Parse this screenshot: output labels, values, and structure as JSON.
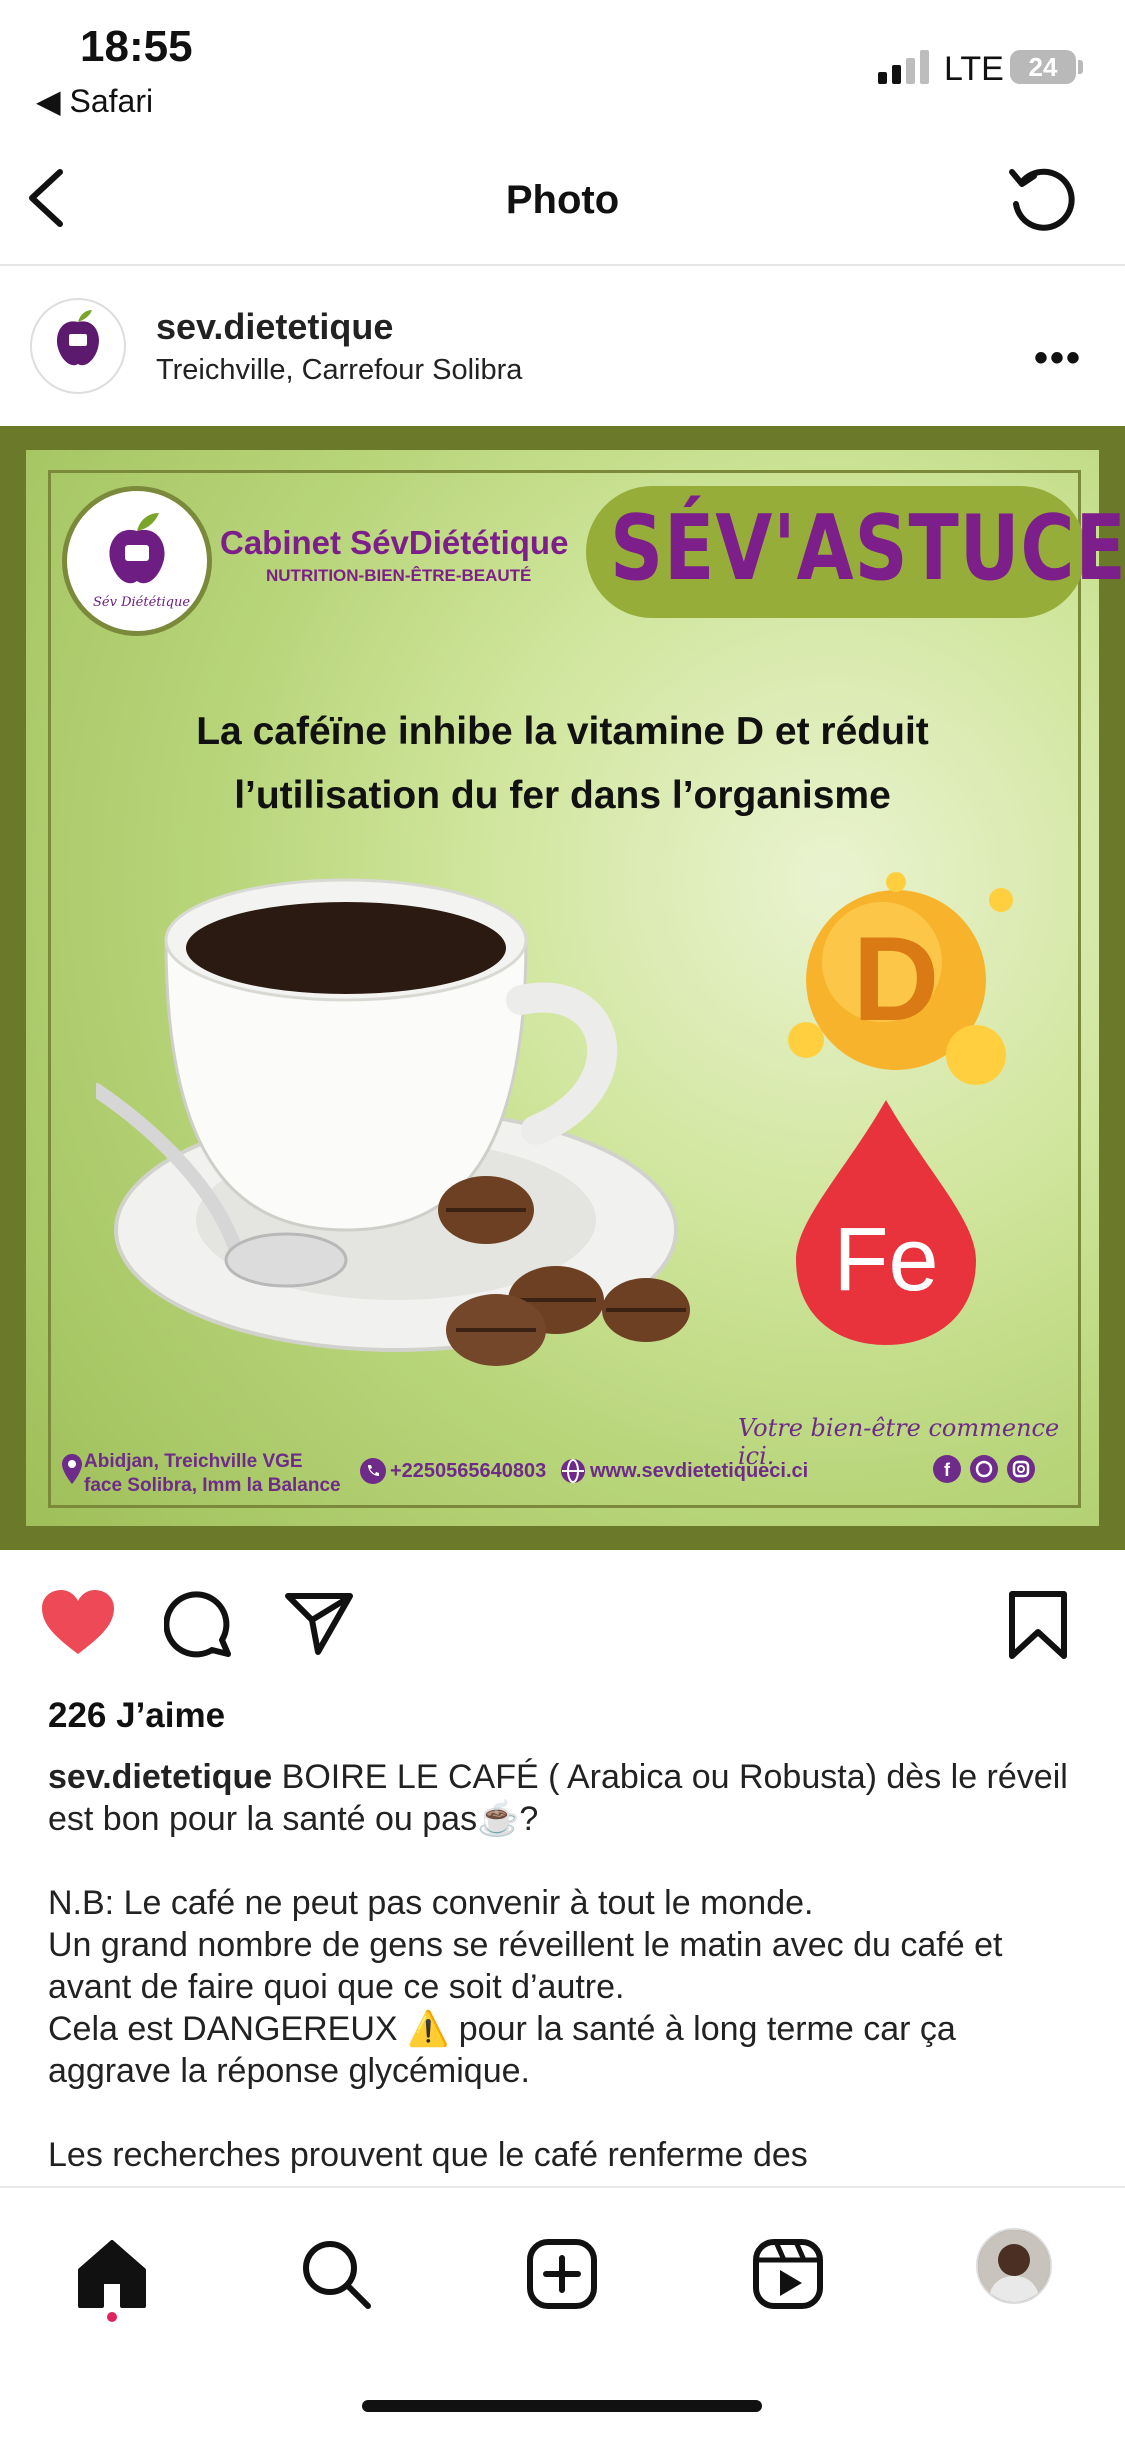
{
  "status_bar": {
    "time": "18:55",
    "back_app": "◀ Safari",
    "network": "LTE",
    "battery": "24"
  },
  "nav": {
    "title": "Photo"
  },
  "post": {
    "username": "sev.dietetique",
    "location": "Treichville, Carrefour Solibra",
    "more_label": "•••",
    "image": {
      "logo_text": "Sév Diététique",
      "brand_title": "Cabinet SévDiététique",
      "brand_subtitle": "NUTRITION-BIEN-ÊTRE-BEAUTÉ",
      "badge": "SÉV'ASTUCE",
      "headline_line1": "La caféïne inhibe la vitamine D et réduit",
      "headline_line2": "l’utilisation du fer dans l’organisme",
      "vitamin_label": "D",
      "iron_label": "Fe",
      "tagline": "Votre bien-être commence ici.",
      "address_line1": "Abidjan, Treichville VGE",
      "address_line2": "face Solibra, Imm la Balance",
      "phone": "+2250565640803",
      "website": "www.sevdietetiqueci.ci"
    },
    "likes": "226 J’aime",
    "caption": {
      "user": "sev.dietetique",
      "line1": " BOIRE LE CAFÉ ( Arabica ou Robusta) dès le réveil est bon pour la santé ou pas☕?",
      "line2": "N.B: Le café ne peut pas convenir à tout le monde.",
      "line3": "Un grand nombre de gens se réveillent le matin avec du café et avant de faire quoi que ce soit d’autre.",
      "line4": "Cela est DANGEREUX ⚠️ pour la santé à long terme car ça aggrave la réponse glycémique.",
      "line5": "Les recherches prouvent que le café renferme des"
    }
  },
  "colors": {
    "like_red": "#ed4956",
    "brand_purple": "#7d1f8a",
    "brand_green": "#97ad3a"
  },
  "icons": [
    "back-chevron-icon",
    "refresh-icon",
    "more-icon",
    "heart-icon",
    "comment-icon",
    "share-icon",
    "bookmark-icon",
    "home-icon",
    "search-icon",
    "create-icon",
    "reels-icon",
    "profile-avatar"
  ]
}
